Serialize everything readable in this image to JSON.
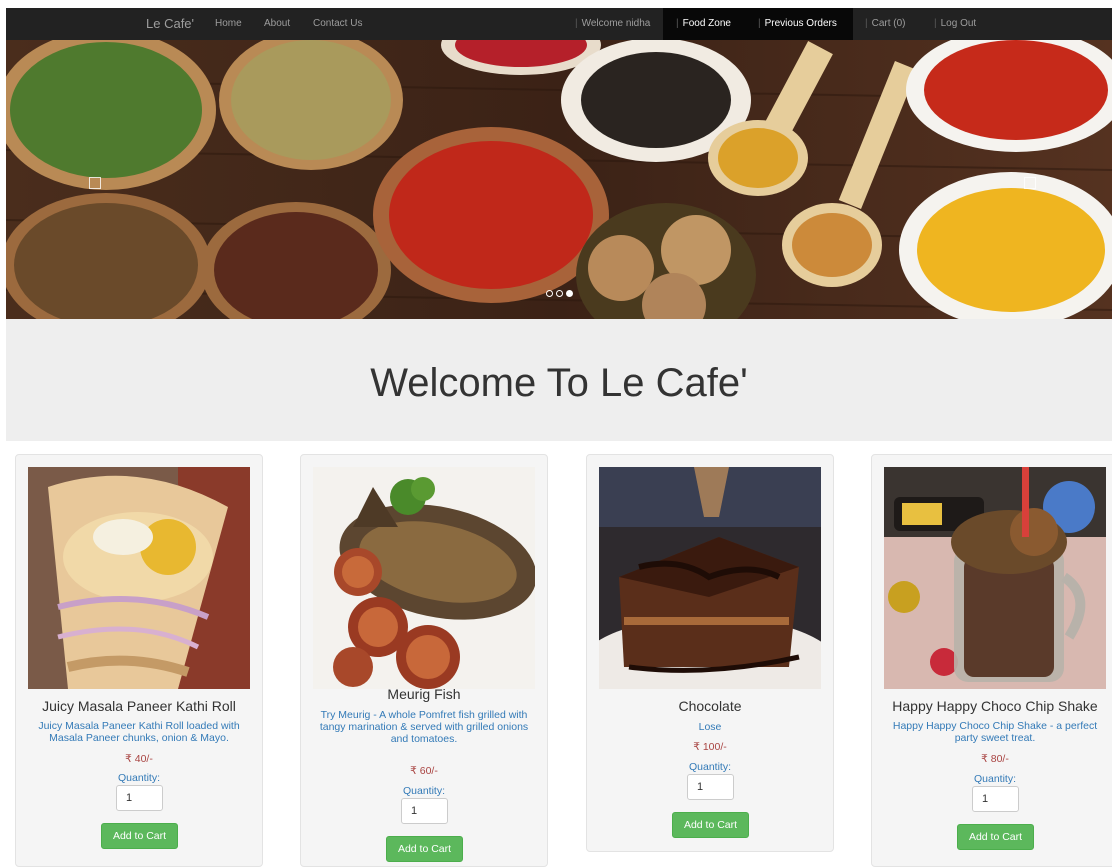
{
  "navbar": {
    "brand": "Le Cafe'",
    "links": [
      "Home",
      "About",
      "Contact Us"
    ],
    "welcome": "Welcome nidha",
    "food_zone": "Food Zone",
    "previous_orders": "Previous Orders",
    "cart": "Cart (0)",
    "logout": "Log Out"
  },
  "carousel": {
    "slide_count": 3,
    "active_index": 2
  },
  "jumbotron": {
    "heading": "Welcome To Le Cafe'"
  },
  "products": [
    {
      "name": "Juicy Masala Paneer Kathi Roll",
      "description": "Juicy Masala Paneer Kathi Roll loaded with Masala Paneer chunks, onion & Mayo.",
      "price": "₹ 40/-",
      "quantity_label": "Quantity:",
      "quantity": "1",
      "button": "Add to Cart"
    },
    {
      "name": "Meurig Fish",
      "description": "Try Meurig - A whole Pomfret fish grilled with tangy marination & served with grilled onions and tomatoes.",
      "price": "₹ 60/-",
      "quantity_label": "Quantity:",
      "quantity": "1",
      "button": "Add to Cart"
    },
    {
      "name": "Chocolate",
      "description": "Lose",
      "price": "₹ 100/-",
      "quantity_label": "Quantity:",
      "quantity": "1",
      "button": "Add to Cart"
    },
    {
      "name": "Happy Happy Choco Chip Shake",
      "description": "Happy Happy Choco Chip Shake - a perfect party sweet treat.",
      "price": "₹ 80/-",
      "quantity_label": "Quantity:",
      "quantity": "1",
      "button": "Add to Cart"
    }
  ],
  "colors": {
    "navbar_bg": "#222222",
    "button_green": "#5cb85c",
    "link_blue": "#337ab7",
    "price_red": "#a94442"
  }
}
